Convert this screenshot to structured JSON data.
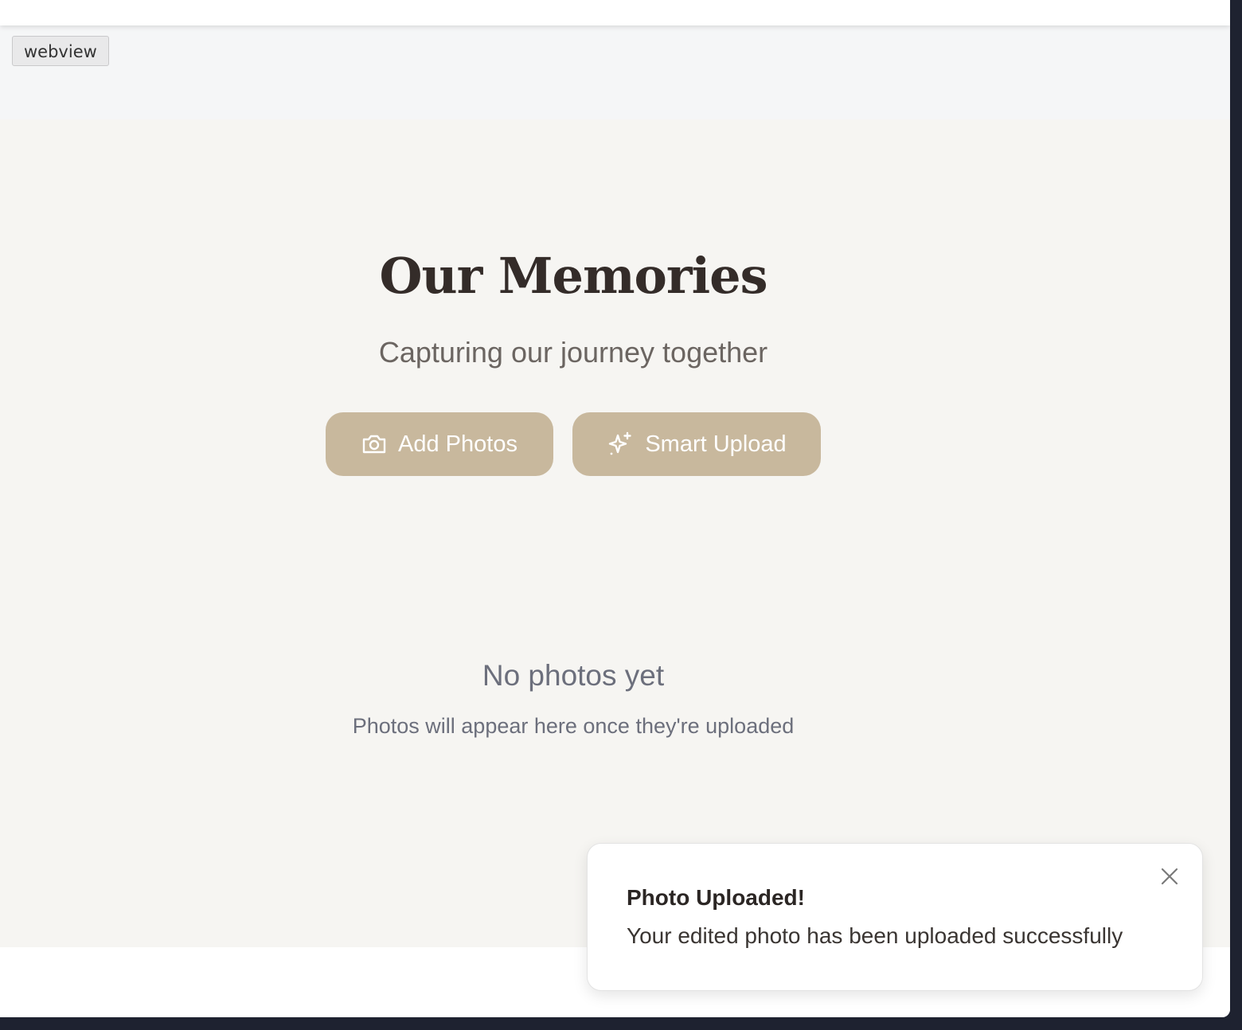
{
  "webview_label": "webview",
  "hero": {
    "title": "Our Memories",
    "subtitle": "Capturing our journey together"
  },
  "actions": {
    "add_photos_label": "Add Photos",
    "add_photos_icon": "camera-icon",
    "smart_upload_label": "Smart Upload",
    "smart_upload_icon": "sparkles-icon"
  },
  "empty_state": {
    "title": "No photos yet",
    "subtitle": "Photos will appear here once they're uploaded"
  },
  "toast": {
    "title": "Photo Uploaded!",
    "message": "Your edited photo has been uploaded successfully",
    "close_icon": "close-icon"
  },
  "colors": {
    "accent": "#c8b89d",
    "page_background": "#f6f5f2",
    "heading": "#342c29",
    "muted_text": "#6c6f7c"
  }
}
